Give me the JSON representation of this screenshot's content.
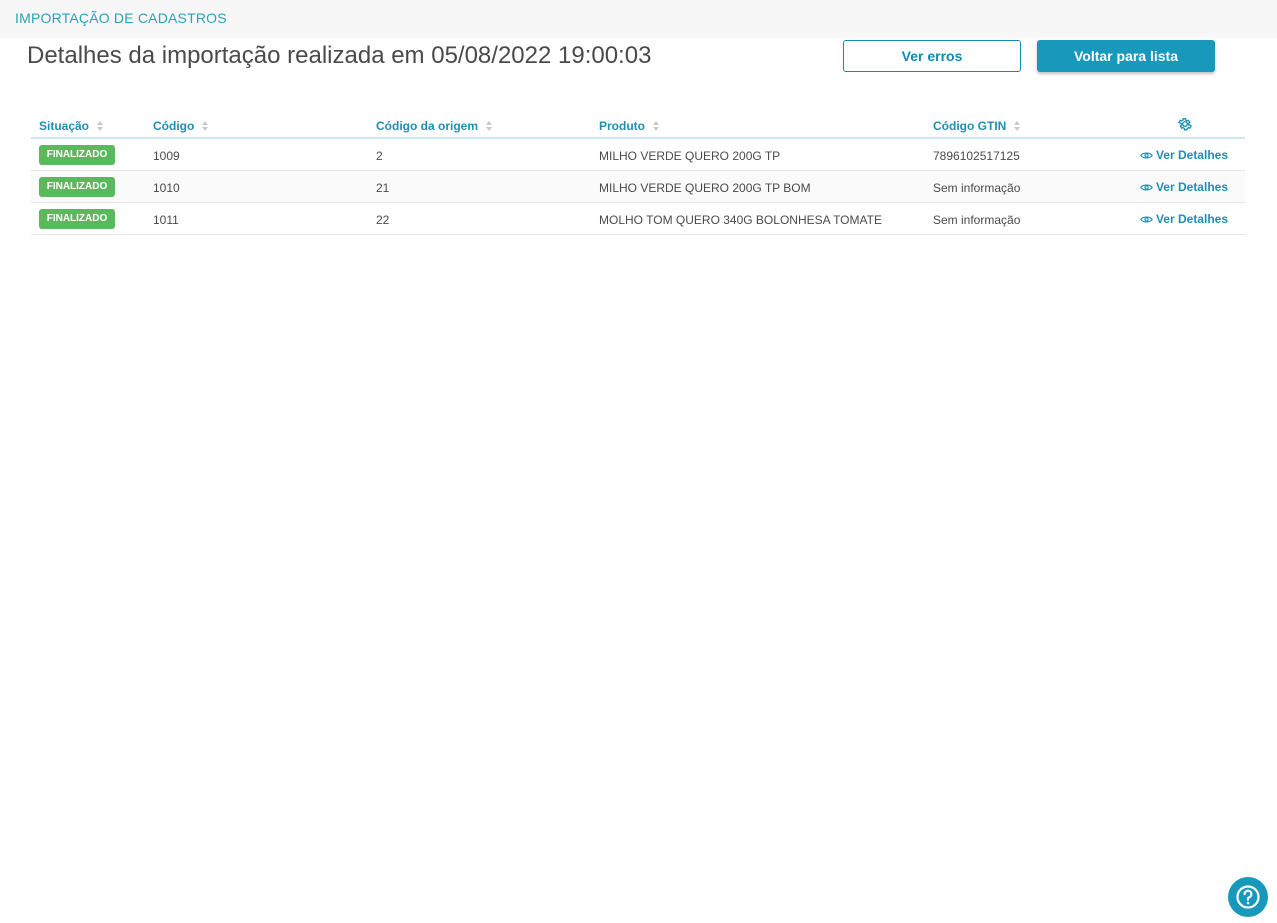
{
  "header": {
    "section_title": "IMPORTAÇÃO DE CADASTROS"
  },
  "page": {
    "title": "Detalhes da importação realizada em 05/08/2022 19:00:03"
  },
  "actions": {
    "errors_label": "Ver erros",
    "back_label": "Voltar para lista"
  },
  "table": {
    "columns": [
      "Situação",
      "Código",
      "Código da origem",
      "Produto",
      "Código GTIN"
    ],
    "rows": [
      {
        "status": "FINALIZADO",
        "code": "1009",
        "origin_code": "2",
        "product": "MILHO VERDE QUERO 200G TP",
        "gtin": "7896102517125",
        "action": "Ver Detalhes"
      },
      {
        "status": "FINALIZADO",
        "code": "1010",
        "origin_code": "21",
        "product": "MILHO VERDE QUERO 200G TP BOM",
        "gtin": "Sem informação",
        "action": "Ver Detalhes"
      },
      {
        "status": "FINALIZADO",
        "code": "1011",
        "origin_code": "22",
        "product": "MOLHO TOM QUERO 340G BOLONHESA TOMATE",
        "gtin": "Sem informação",
        "action": "Ver Detalhes"
      }
    ]
  },
  "colors": {
    "accent": "#1898bb",
    "link": "#1f8fb2",
    "status_success": "#5cb85c"
  },
  "icons": {
    "sort": "sort-icon",
    "settings": "gear-icon",
    "view": "eye-icon",
    "help": "help-icon"
  }
}
